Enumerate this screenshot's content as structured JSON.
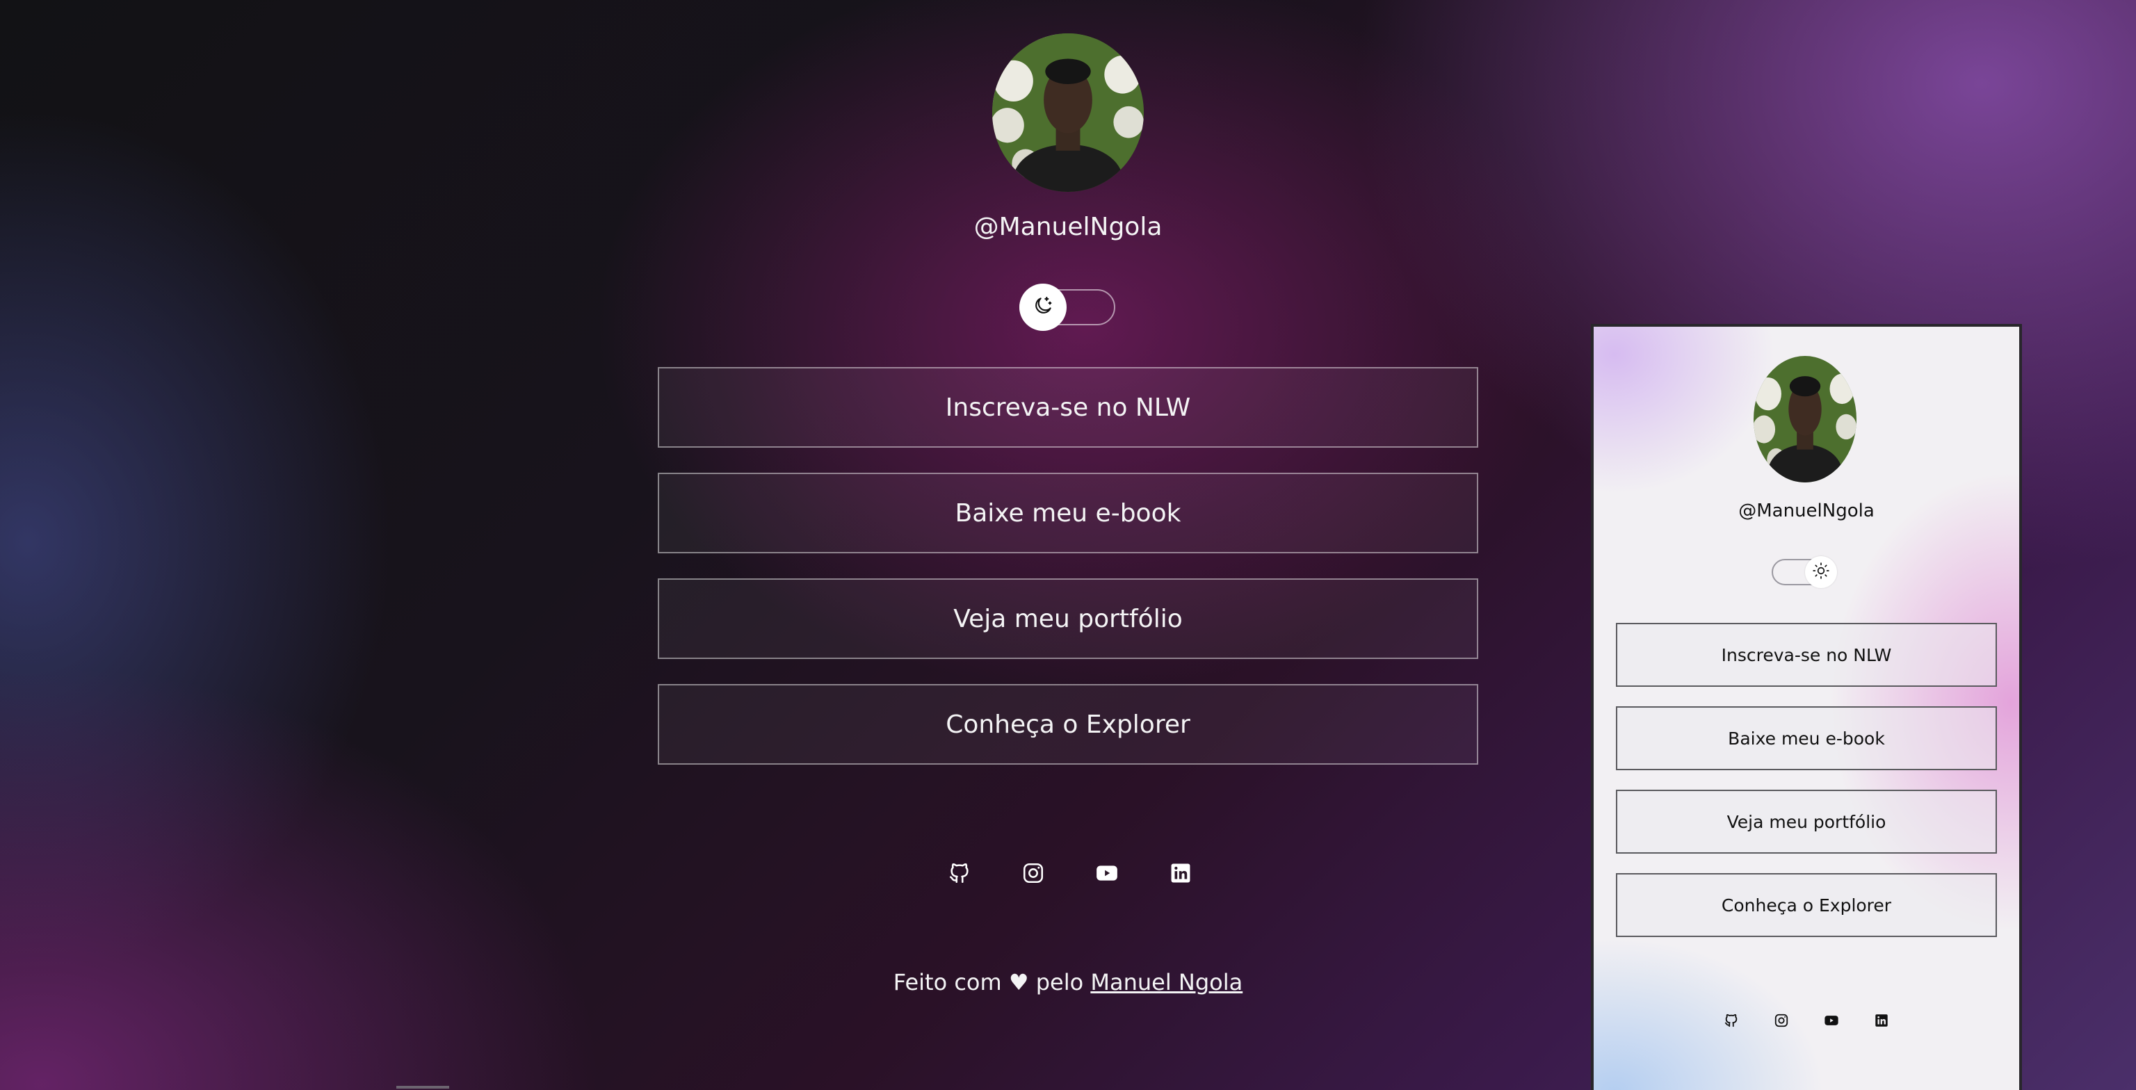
{
  "profile": {
    "handle": "@ManuelNgola",
    "avatar_alt": "Manuel Ngola"
  },
  "theme_toggle": {
    "main_state": "dark",
    "main_icon": "moon-stars-icon",
    "preview_state": "light",
    "preview_icon": "sun-icon"
  },
  "links": [
    {
      "label": "Inscreva-se no NLW"
    },
    {
      "label": "Baixe meu e-book"
    },
    {
      "label": "Veja meu portfólio"
    },
    {
      "label": "Conheça o Explorer"
    }
  ],
  "social": [
    "github-icon",
    "instagram-icon",
    "youtube-icon",
    "linkedin-icon"
  ],
  "footer": {
    "prefix": "Feito com ♥ pelo",
    "author": "Manuel Ngola"
  },
  "colors": {
    "dark_text": "#f4f4f5",
    "light_text": "#111111",
    "accent_purple": "#731c5f",
    "accent_violet": "#874eaa"
  }
}
